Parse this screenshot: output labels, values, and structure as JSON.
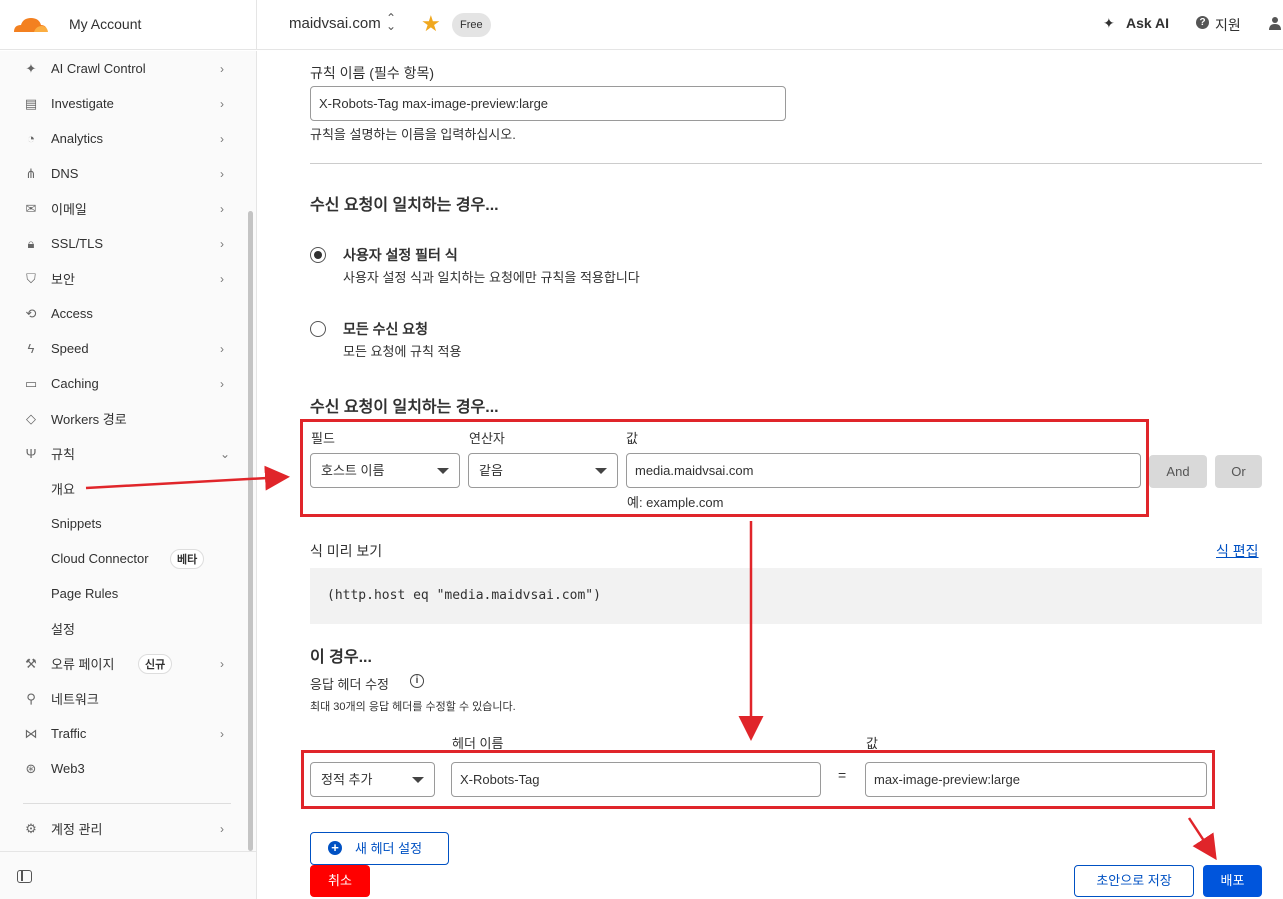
{
  "header": {
    "account": "My Account",
    "domain": "maidvsai.com",
    "plan_badge": "Free",
    "ask_ai": "Ask AI",
    "help": "지원"
  },
  "sidebar": {
    "items": [
      {
        "label": "AI Crawl Control",
        "icon": "sparkle-icon"
      },
      {
        "label": "Investigate",
        "icon": "investigate-icon"
      },
      {
        "label": "Analytics",
        "icon": "analytics-icon"
      },
      {
        "label": "DNS",
        "icon": "dns-icon"
      },
      {
        "label": "이메일",
        "icon": "email-icon"
      },
      {
        "label": "SSL/TLS",
        "icon": "lock-icon"
      },
      {
        "label": "보안",
        "icon": "shield-icon"
      },
      {
        "label": "Access",
        "icon": "access-icon"
      },
      {
        "label": "Speed",
        "icon": "bolt-icon"
      },
      {
        "label": "Caching",
        "icon": "caching-icon"
      },
      {
        "label": "Workers 경로",
        "icon": "workers-icon"
      },
      {
        "label": "규칙",
        "icon": "rules-icon"
      }
    ],
    "rules_subitems": [
      {
        "label": "개요"
      },
      {
        "label": "Snippets"
      },
      {
        "label": "Cloud Connector",
        "badge": "베타"
      },
      {
        "label": "Page Rules"
      },
      {
        "label": "설정"
      }
    ],
    "items_after": [
      {
        "label": "오류 페이지",
        "badge": "신규",
        "icon": "wrench-icon"
      },
      {
        "label": "네트워크",
        "icon": "pin-icon"
      },
      {
        "label": "Traffic",
        "icon": "traffic-icon"
      },
      {
        "label": "Web3",
        "icon": "web3-icon"
      }
    ],
    "manage_account": "계정 관리"
  },
  "form": {
    "rule_name_label": "규칙 이름 (필수 항목)",
    "rule_name_value": "X-Robots-Tag max-image-preview:large",
    "rule_name_help": "규칙을 설명하는 이름을 입력하십시오.",
    "match_heading": "수신 요청이 일치하는 경우...",
    "option_custom_title": "사용자 설정 필터 식",
    "option_custom_desc": "사용자 설정 식과 일치하는 요청에만 규칙을 적용합니다",
    "option_all_title": "모든 수신 요청",
    "option_all_desc": "모든 요청에 규칙 적용",
    "match_heading_2": "수신 요청이 일치하는 경우...",
    "field_label": "필드",
    "operator_label": "연산자",
    "value_label": "값",
    "field_value": "호스트 이름",
    "operator_value": "같음",
    "value_value": "media.maidvsai.com",
    "value_hint": "예: example.com",
    "and_button": "And",
    "or_button": "Or",
    "preview_label": "식 미리 보기",
    "edit_expression": "식 편집",
    "preview_expression": "(http.host eq \"media.maidvsai.com\")",
    "then_heading": "이 경우...",
    "modify_header_label": "응답 헤더 수정",
    "modify_header_help": "최대 30개의 응답 헤더를 수정할 수 있습니다.",
    "header_name_label": "헤더 이름",
    "header_value_label": "값",
    "header_op_value": "정적 추가",
    "header_name_value": "X-Robots-Tag",
    "equals": "=",
    "header_value_value": "max-image-preview:large",
    "new_header_button": "새 헤더 설정",
    "cancel_button": "취소",
    "save_draft_button": "초안으로 저장",
    "deploy_button": "배포"
  },
  "colors": {
    "accent_blue": "#0051c3",
    "annotation_red": "#e0252a",
    "cancel_red": "#ff0000",
    "logo_orange": "#f38020"
  }
}
